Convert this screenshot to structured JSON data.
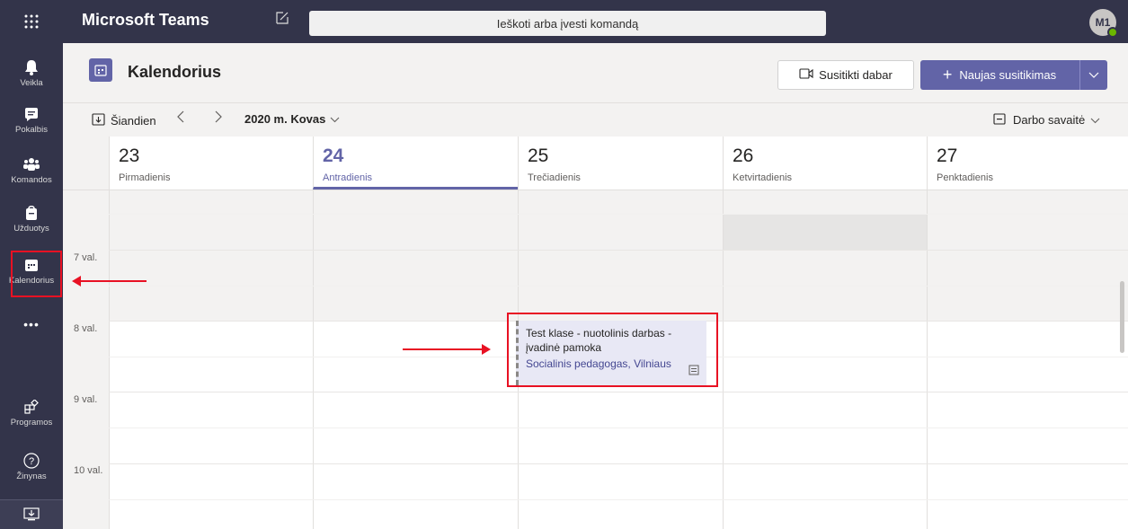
{
  "app": {
    "title": "Microsoft Teams",
    "search_placeholder": "Ieškoti arba įvesti komandą",
    "avatar_initials": "M1",
    "status_color": "#6bb700",
    "brand_color": "#6264a7",
    "bar_color": "#33344a"
  },
  "rail": {
    "items": [
      {
        "label": "Veikla",
        "icon": "bell-icon"
      },
      {
        "label": "Pokalbis",
        "icon": "chat-icon"
      },
      {
        "label": "Komandos",
        "icon": "teams-icon"
      },
      {
        "label": "Užduotys",
        "icon": "assignments-icon"
      },
      {
        "label": "Kalendorius",
        "icon": "calendar-icon"
      },
      {
        "label": "Programos",
        "icon": "apps-icon"
      },
      {
        "label": "Žinynas",
        "icon": "help-icon"
      }
    ],
    "more": "•••"
  },
  "header": {
    "title": "Kalendorius",
    "meet_now": "Susitikti dabar",
    "new_meeting": "Naujas susitikimas"
  },
  "toolbar": {
    "today": "Šiandien",
    "month": "2020 m. Kovas",
    "view": "Darbo savaitė"
  },
  "days": [
    {
      "num": "23",
      "name": "Pirmadienis"
    },
    {
      "num": "24",
      "name": "Antradienis"
    },
    {
      "num": "25",
      "name": "Trečiadienis"
    },
    {
      "num": "26",
      "name": "Ketvirtadienis"
    },
    {
      "num": "27",
      "name": "Penktadienis"
    }
  ],
  "times": [
    "7 val.",
    "8 val.",
    "9 val.",
    "10 val."
  ],
  "event": {
    "title": "Test klase - nuotolinis darbas - įvadinė pamoka",
    "location": "Socialinis pedagogas, Vilniaus"
  }
}
